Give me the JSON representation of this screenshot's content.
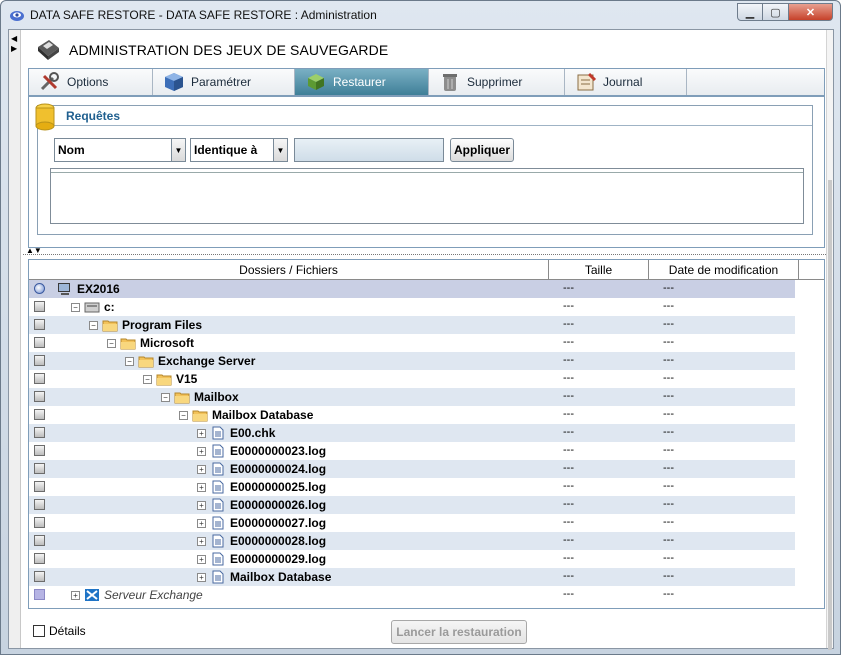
{
  "window": {
    "title": "DATA SAFE RESTORE - DATA SAFE RESTORE : Administration",
    "controls": {
      "minimize": "▁",
      "maximize": "▢",
      "close": "✕"
    }
  },
  "page": {
    "title": "ADMINISTRATION DES JEUX DE SAUVEGARDE"
  },
  "tabs": [
    {
      "label": "Options",
      "icon": "tools-icon"
    },
    {
      "label": "Paramétrer",
      "icon": "cube-icon"
    },
    {
      "label": "Restaurer",
      "icon": "restore-icon",
      "active": true
    },
    {
      "label": "Supprimer",
      "icon": "trash-icon"
    },
    {
      "label": "Journal",
      "icon": "journal-icon"
    }
  ],
  "requetes": {
    "title": "Requêtes",
    "field_select": "Nom",
    "operator_select": "Identique à",
    "value": "",
    "apply_label": "Appliquer"
  },
  "table": {
    "columns": {
      "name": "Dossiers / Fichiers",
      "size": "Taille",
      "date": "Date de modification"
    },
    "rows": [
      {
        "label": "EX2016",
        "size": "---",
        "date": "---"
      },
      {
        "label": "c:",
        "size": "---",
        "date": "---"
      },
      {
        "label": "Program Files",
        "size": "---",
        "date": "---"
      },
      {
        "label": "Microsoft",
        "size": "---",
        "date": "---"
      },
      {
        "label": "Exchange Server",
        "size": "---",
        "date": "---"
      },
      {
        "label": "V15",
        "size": "---",
        "date": "---"
      },
      {
        "label": "Mailbox",
        "size": "---",
        "date": "---"
      },
      {
        "label": "Mailbox Database",
        "size": "---",
        "date": "---"
      },
      {
        "label": "E00.chk",
        "size": "---",
        "date": "---"
      },
      {
        "label": "E0000000023.log",
        "size": "---",
        "date": "---"
      },
      {
        "label": "E0000000024.log",
        "size": "---",
        "date": "---"
      },
      {
        "label": "E0000000025.log",
        "size": "---",
        "date": "---"
      },
      {
        "label": "E0000000026.log",
        "size": "---",
        "date": "---"
      },
      {
        "label": "E0000000027.log",
        "size": "---",
        "date": "---"
      },
      {
        "label": "E0000000028.log",
        "size": "---",
        "date": "---"
      },
      {
        "label": "E0000000029.log",
        "size": "---",
        "date": "---"
      },
      {
        "label": "Mailbox Database",
        "size": "---",
        "date": "---"
      },
      {
        "label": "Serveur Exchange",
        "size": "---",
        "date": "---"
      }
    ]
  },
  "footer": {
    "details_label": "Détails",
    "restore_label": "Lancer la restauration"
  },
  "colors": {
    "accent": "#3f7f98",
    "alt_row": "#dfe7f1",
    "header_blue": "#1f5f8f"
  }
}
